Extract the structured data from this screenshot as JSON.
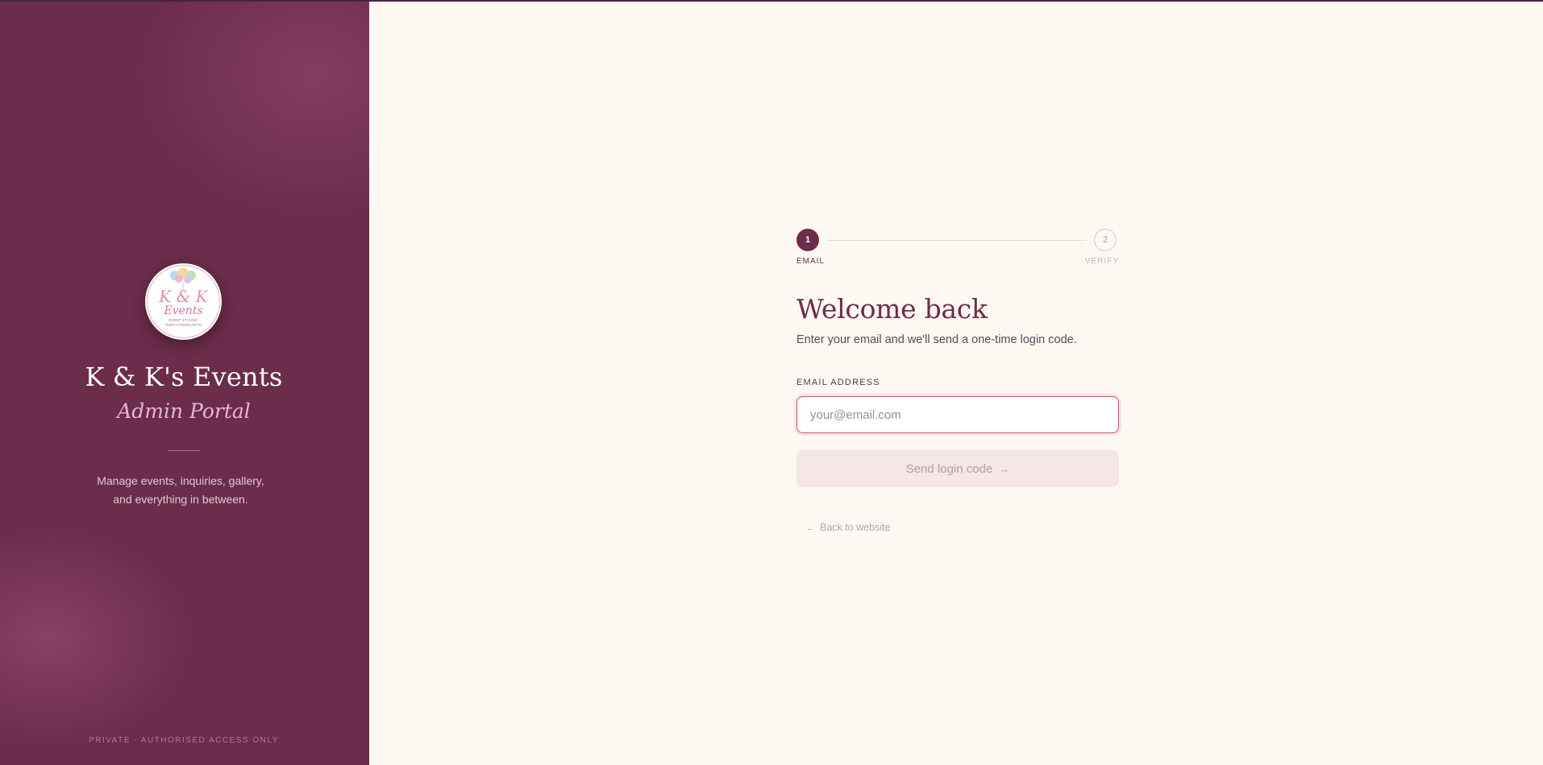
{
  "brand": {
    "name": "K & K's Events",
    "subtitle": "Admin Portal",
    "tagline_line1": "Manage events, inquiries, gallery,",
    "tagline_line2": "and everything in between.",
    "footer": "PRIVATE · AUTHORISED ACCESS ONLY",
    "logo_text_main": "K & K",
    "logo_text_script": "Events",
    "logo_text_small1": "EVENT STYLING",
    "logo_text_small2": "PARTY FOODCARTS"
  },
  "stepper": {
    "steps": [
      {
        "number": "1",
        "label": "EMAIL",
        "active": true
      },
      {
        "number": "2",
        "label": "VERIFY",
        "active": false
      }
    ]
  },
  "form": {
    "title": "Welcome back",
    "subtitle": "Enter your email and we'll send a one-time login code.",
    "email_label": "EMAIL ADDRESS",
    "email_placeholder": "your@email.com",
    "email_value": "",
    "submit_label": "Send login code",
    "back_label": "Back to website"
  },
  "icons": {
    "submit": "arrow-right-icon",
    "back": "arrow-left-icon"
  },
  "colors": {
    "brand_panel": "#6b2d4a",
    "accent": "#6b2d4a",
    "background": "#fef8f3",
    "input_focus": "#c4577f",
    "button_disabled": "#f3e6e4"
  }
}
